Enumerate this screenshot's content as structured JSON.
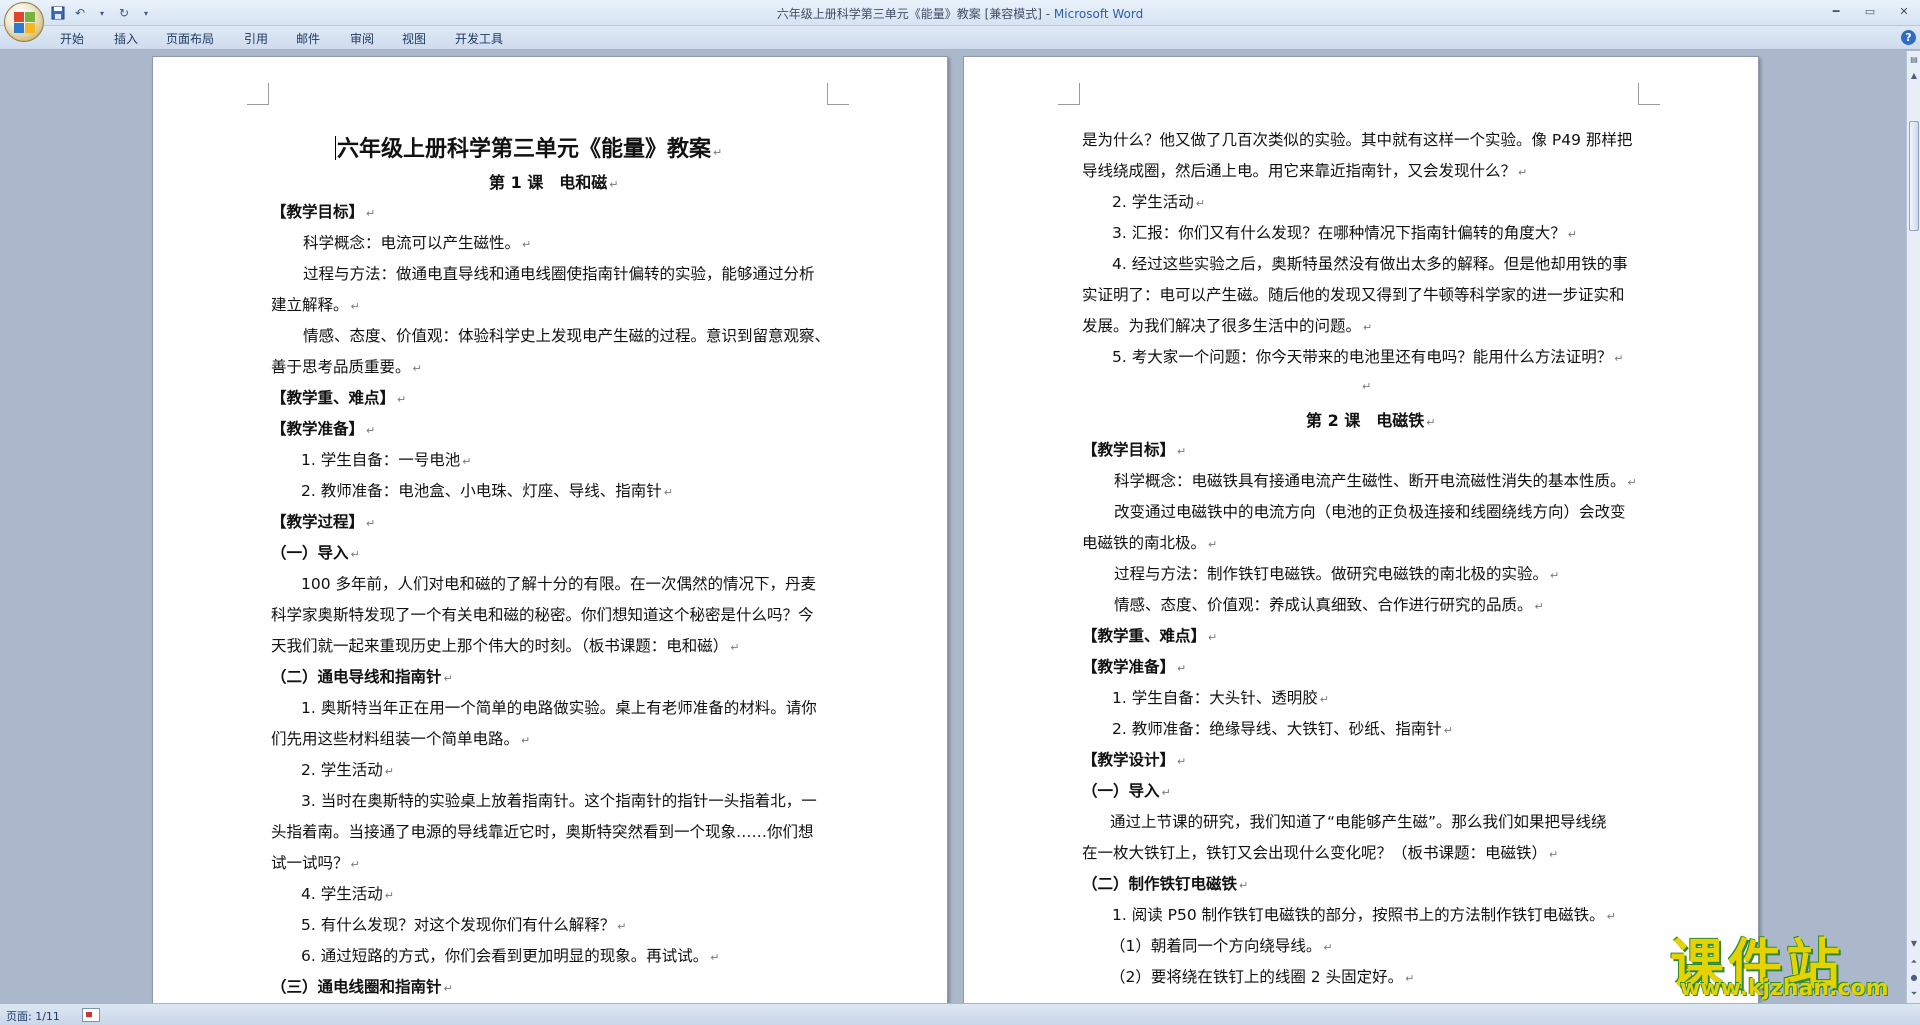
{
  "window": {
    "title_doc": "六年级上册科学第三单元《能量》教案 [兼容模式] - ",
    "title_app": "Microsoft Word"
  },
  "ribbon": {
    "tabs": [
      "开始",
      "插入",
      "页面布局",
      "引用",
      "邮件",
      "审阅",
      "视图",
      "开发工具"
    ]
  },
  "status": {
    "page": "页面: 1/11"
  },
  "watermark": {
    "text": "课件站",
    "url": "www.kjzhan.com"
  },
  "left_page": {
    "title": "六年级上册科学第三单元《能量》教案",
    "lesson": "第 1 课　电和磁",
    "lines": [
      "【教学目标】",
      "科学概念：电流可以产生磁性。",
      "过程与方法：做通电直导线和通电线圈使指南针偏转的实验，能够通过分析",
      "建立解释。",
      "情感、态度、价值观：体验科学史上发现电产生磁的过程。意识到留意观察、",
      "善于思考品质重要。",
      "【教学重、难点】",
      "【教学准备】",
      "1. 学生自备：一号电池",
      "2. 教师准备：电池盒、小电珠、灯座、导线、指南针",
      "【教学过程】",
      "（一）导入",
      "100 多年前，人们对电和磁的了解十分的有限。在一次偶然的情况下，丹麦",
      "科学家奥斯特发现了一个有关电和磁的秘密。你们想知道这个秘密是什么吗？今",
      "天我们就一起来重现历史上那个伟大的时刻。（板书课题：电和磁）",
      "（二）通电导线和指南针",
      "1. 奥斯特当年正在用一个简单的电路做实验。桌上有老师准备的材料。请你",
      "们先用这些材料组装一个简单电路。",
      "2. 学生活动",
      "3. 当时在奥斯特的实验桌上放着指南针。这个指南针的指针一头指着北，一",
      "头指着南。当接通了电源的导线靠近它时，奥斯特突然看到一个现象……你们想",
      "试一试吗？",
      "4. 学生活动",
      "5. 有什么发现？对这个发现你们有什么解释？",
      "6. 通过短路的方式，你们会看到更加明显的现象。再试试。",
      "（三）通电线圈和指南针"
    ]
  },
  "right_page": {
    "lines": [
      "是为什么？他又做了几百次类似的实验。其中就有这样一个实验。像 P49 那样把",
      "导线绕成圈，然后通上电。用它来靠近指南针，又会发现什么？",
      "2. 学生活动",
      "3. 汇报：你们又有什么发现？在哪种情况下指南针偏转的角度大？",
      "4. 经过这些实验之后，奥斯特虽然没有做出太多的解释。但是他却用铁的事",
      "实证明了：电可以产生磁。随后他的发现又得到了牛顿等科学家的进一步证实和",
      "发展。为我们解决了很多生活中的问题。",
      "5. 考大家一个问题：你今天带来的电池里还有电吗？能用什么方法证明？",
      "",
      "第 2 课　电磁铁",
      "【教学目标】",
      "科学概念：电磁铁具有接通电流产生磁性、断开电流磁性消失的基本性质。",
      "改变通过电磁铁中的电流方向（电池的正负极连接和线圈绕线方向）会改变",
      "电磁铁的南北极。",
      "过程与方法：制作铁钉电磁铁。做研究电磁铁的南北极的实验。",
      "情感、态度、价值观：养成认真细致、合作进行研究的品质。",
      "【教学重、难点】",
      "【教学准备】",
      "1. 学生自备：大头针、透明胶",
      "2. 教师准备：绝缘导线、大铁钉、砂纸、指南针",
      "【教学设计】",
      "（一）导入",
      "通过上节课的研究，我们知道了“电能够产生磁”。那么我们如果把导线绕",
      "在一枚大铁钉上，铁钉又会出现什么变化呢？（板书课题：电磁铁）",
      "（二）制作铁钉电磁铁",
      "1. 阅读 P50 制作铁钉电磁铁的部分，按照书上的方法制作铁钉电磁铁。",
      "（1）朝着同一个方向绕导线。",
      "（2）要将绕在铁钉上的线圈 2 头固定好。"
    ]
  }
}
